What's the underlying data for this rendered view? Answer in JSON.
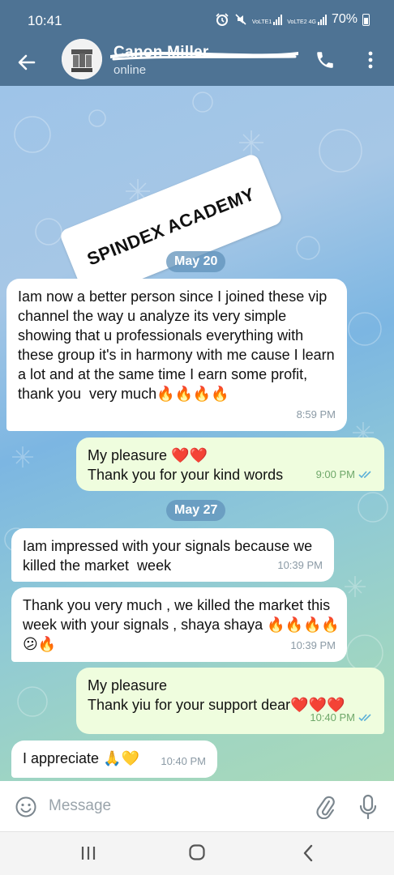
{
  "status_bar": {
    "time": "10:41",
    "net1_label": "VoLTE1",
    "net2_label": "VoLTE2",
    "net2_type": "4G",
    "battery": "70%"
  },
  "header": {
    "contact_name": "Canon Miller",
    "presence": "online"
  },
  "sticker_text": "SPINDEX ACADEMY",
  "dates": [
    "May 20",
    "May 27"
  ],
  "messages": [
    {
      "dir": "in",
      "text": "Iam now a better person since I joined these vip channel the way u analyze its very simple showing that u professionals everything with these group it's in harmony with me cause I learn a lot and at the same time I earn some profit,  thank you  very much🔥🔥🔥🔥",
      "time": "8:59 PM"
    },
    {
      "dir": "out",
      "text": "My pleasure ❤️❤️\nThank you for your kind words",
      "time": "9:00 PM"
    },
    {
      "dir": "in",
      "text": "Iam impressed with your signals because we killed the market  week",
      "time": "10:39 PM"
    },
    {
      "dir": "in",
      "text": "Thank you very much , we killed the market this week with your signals , shaya shaya 🔥🔥🔥🔥😕🔥",
      "time": "10:39 PM"
    },
    {
      "dir": "out",
      "text": "My pleasure\nThank yiu for your support dear❤️❤️❤️",
      "time": "10:40 PM"
    },
    {
      "dir": "in",
      "text": "I appreciate 🙏💛",
      "time": "10:40 PM"
    }
  ],
  "input": {
    "placeholder": "Message"
  },
  "icons": {
    "back": "arrow-left-icon",
    "call": "phone-icon",
    "menu": "more-vert-icon",
    "emoji": "smiley-icon",
    "attach": "paperclip-icon",
    "mic": "microphone-icon",
    "read": "double-check-icon"
  },
  "colors": {
    "header": "#4e7394",
    "incoming_bubble": "#ffffff",
    "outgoing_bubble": "#effdde",
    "read_ticks": "#6fa86a"
  }
}
